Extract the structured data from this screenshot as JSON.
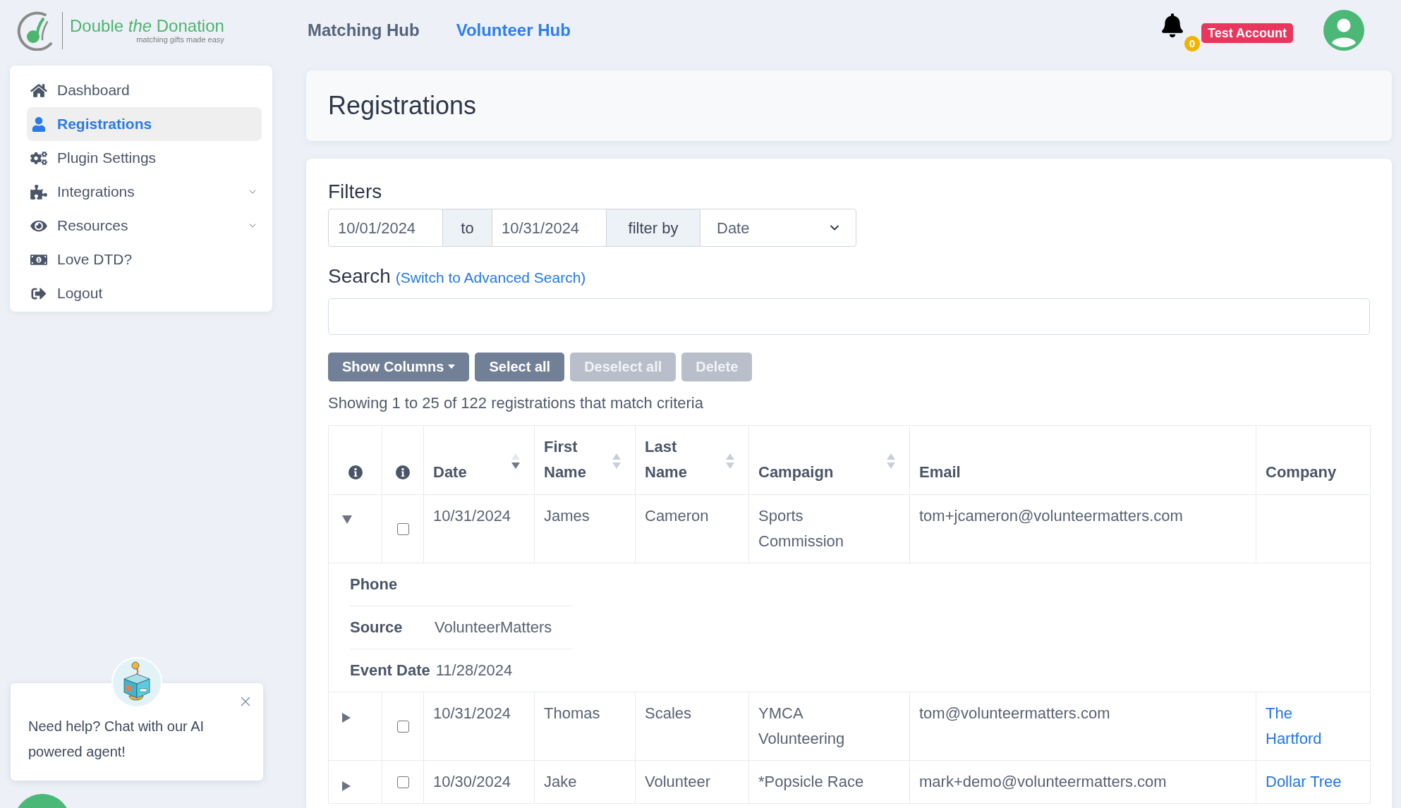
{
  "header": {
    "logo": {
      "wordmark": "Double *the* Donation",
      "tagline": "matching gifts made easy"
    },
    "nav": [
      {
        "label": "Matching Hub",
        "selected": false
      },
      {
        "label": "Volunteer Hub",
        "selected": true
      }
    ],
    "notifications": {
      "count": "0"
    },
    "account_badge": "Test Account"
  },
  "sidebar": {
    "items": [
      {
        "label": "Dashboard",
        "selected": false,
        "submenu": false
      },
      {
        "label": "Registrations",
        "selected": true,
        "submenu": false
      },
      {
        "label": "Plugin Settings",
        "selected": false,
        "submenu": false
      },
      {
        "label": "Integrations",
        "selected": false,
        "submenu": true
      },
      {
        "label": "Resources",
        "selected": false,
        "submenu": true
      },
      {
        "label": "Love DTD?",
        "selected": false,
        "submenu": false
      },
      {
        "label": "Logout",
        "selected": false,
        "submenu": false
      }
    ]
  },
  "page_title": "Registrations",
  "filters": {
    "title": "Filters",
    "start_date": "10/01/2024",
    "separator": "to",
    "end_date": "10/31/2024",
    "filter_by_label": "filter by",
    "filter_by_value": "Date"
  },
  "search": {
    "title": "Search",
    "link": "(Switch to Advanced Search)"
  },
  "buttons": [
    {
      "label": "Show Columns",
      "kind": "dropdown",
      "disabled": false
    },
    {
      "label": "Select all",
      "kind": "plain",
      "disabled": false
    },
    {
      "label": "Deselect all",
      "kind": "plain",
      "disabled": true
    },
    {
      "label": "Delete",
      "kind": "plain",
      "disabled": true
    }
  ],
  "summary": "Showing 1 to 25 of 122 registrations that match criteria",
  "table": {
    "columns": [
      {
        "kind": "info"
      },
      {
        "kind": "info"
      },
      {
        "kind": "text",
        "label": "Date",
        "sortable": true,
        "sorted": true
      },
      {
        "kind": "text",
        "label": "First Name",
        "sortable": true,
        "sorted": false
      },
      {
        "kind": "text",
        "label": "Last Name",
        "sortable": true,
        "sorted": false
      },
      {
        "kind": "text",
        "label": "Campaign",
        "sortable": true,
        "sorted": false
      },
      {
        "kind": "text",
        "label": "Email",
        "sortable": false
      },
      {
        "kind": "link",
        "label": "Company",
        "sortable": false
      }
    ],
    "rows": [
      {
        "expanded": true,
        "checked": false,
        "date": "10/31/2024",
        "first_name": "James",
        "last_name": "Cameron",
        "campaign": "Sports Commission",
        "email": "tom+jcameron@volunteermatters.com",
        "details": [
          {
            "label": "Phone"
          },
          {
            "label": "Source",
            "value": "VolunteerMatters"
          },
          {
            "label": "Event Date",
            "value": "11/28/2024"
          }
        ]
      },
      {
        "expanded": false,
        "checked": false,
        "date": "10/31/2024",
        "first_name": "Thomas",
        "last_name": "Scales",
        "campaign": "YMCA Volunteering",
        "email": "tom@volunteermatters.com",
        "company": "The Hartford"
      },
      {
        "expanded": false,
        "checked": false,
        "date": "10/30/2024",
        "first_name": "Jake",
        "last_name": "Volunteer",
        "campaign": "*Popsicle Race",
        "email": "mark+demo@volunteermatters.com",
        "company": "Dollar Tree"
      }
    ]
  },
  "chat_widget": {
    "message": "Need help? Chat with our AI powered agent!"
  }
}
